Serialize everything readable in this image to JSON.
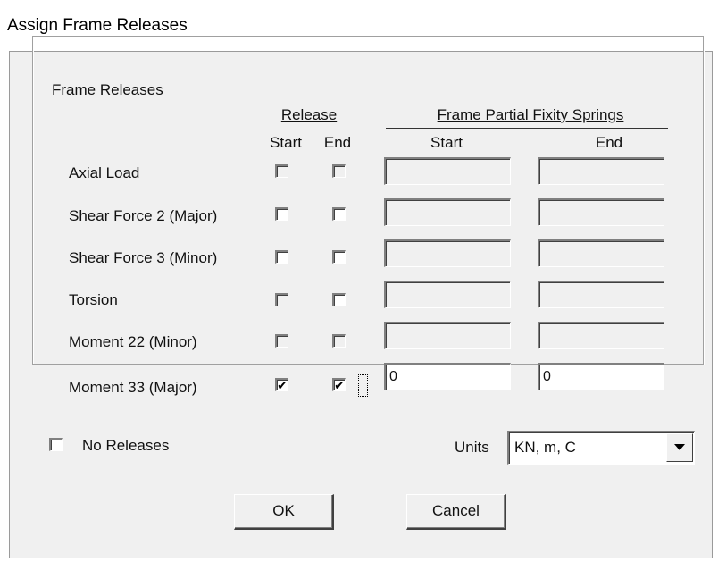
{
  "window": {
    "title": "Assign Frame Releases"
  },
  "group": {
    "title": "Frame Releases",
    "release_header": "Release",
    "springs_header": "Frame Partial Fixity Springs",
    "col_start": "Start",
    "col_end": "End",
    "springs_start": "Start",
    "springs_end": "End"
  },
  "rows": [
    {
      "label": "Axial Load",
      "release_start": false,
      "release_end": false,
      "spring_start": "",
      "spring_end": ""
    },
    {
      "label": "Shear Force 2 (Major)",
      "release_start": false,
      "release_end": false,
      "spring_start": "",
      "spring_end": ""
    },
    {
      "label": "Shear Force 3 (Minor)",
      "release_start": false,
      "release_end": false,
      "spring_start": "",
      "spring_end": ""
    },
    {
      "label": "Torsion",
      "release_start": false,
      "release_end": false,
      "spring_start": "",
      "spring_end": ""
    },
    {
      "label": "Moment 22 (Minor)",
      "release_start": false,
      "release_end": false,
      "spring_start": "",
      "spring_end": ""
    },
    {
      "label": "Moment 33 (Major)",
      "release_start": true,
      "release_end": true,
      "spring_start": "0",
      "spring_end": "0"
    }
  ],
  "no_releases": {
    "label": "No Releases",
    "checked": false
  },
  "units": {
    "label": "Units",
    "value": "KN, m, C"
  },
  "buttons": {
    "ok": "OK",
    "cancel": "Cancel"
  },
  "icons": {
    "dropdown": "chevron-down-icon",
    "check": "checkmark-icon"
  }
}
